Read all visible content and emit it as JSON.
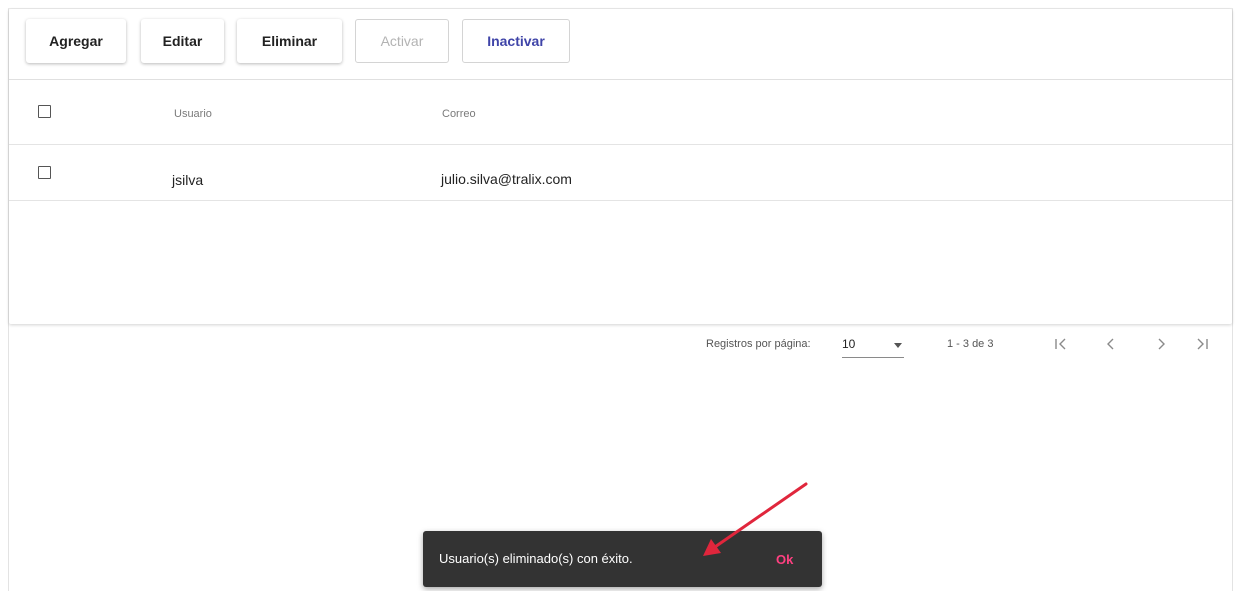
{
  "toolbar": {
    "add_label": "Agregar",
    "edit_label": "Editar",
    "delete_label": "Eliminar",
    "activate_label": "Activar",
    "deactivate_label": "Inactivar"
  },
  "table": {
    "headers": {
      "user": "Usuario",
      "email": "Correo"
    },
    "rows": [
      {
        "user": "jsilva",
        "email": "julio.silva@tralix.com"
      }
    ]
  },
  "paginator": {
    "items_per_page_label": "Registros por página:",
    "page_size": "10",
    "range_label": "1 - 3 de 3",
    "icons": [
      "first-page-icon",
      "previous-page-icon",
      "next-page-icon",
      "last-page-icon"
    ]
  },
  "snackbar": {
    "message": "Usuario(s) eliminado(s) con éxito.",
    "action": "Ok"
  },
  "colors": {
    "accent": "#3f44a8",
    "snackbar_bg": "#333333",
    "snackbar_action": "#ff4081",
    "annotation_arrow": "#e0263c"
  }
}
